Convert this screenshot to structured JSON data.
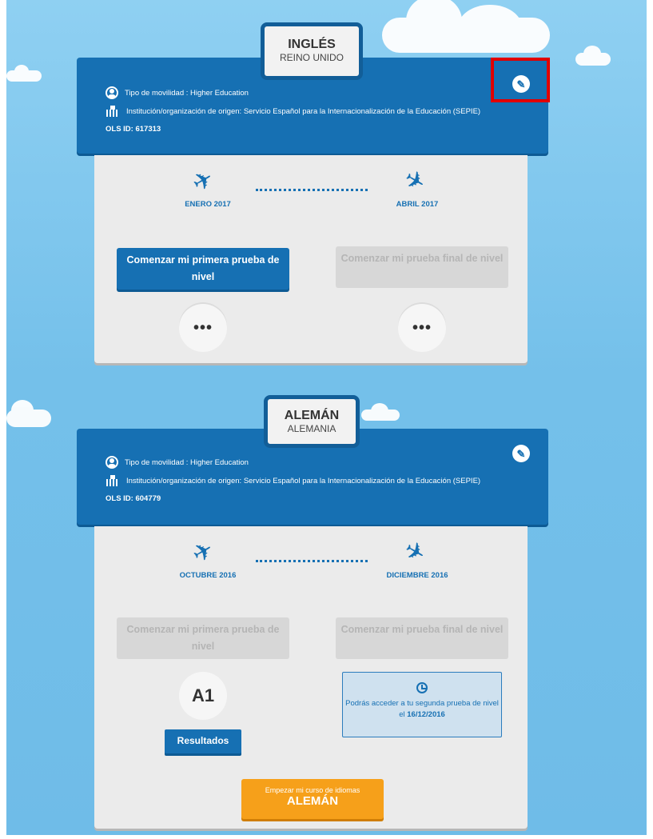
{
  "cards": [
    {
      "language": "INGLÉS",
      "country": "REINO UNIDO",
      "mobility_type": "Tipo de movilidad : Higher Education",
      "institution": "Institución/organización de origen: Servicio Español para la Internacionalización de la Educación (SEPIE)",
      "ols_id": "OLS ID: 617313",
      "start_date": "ENERO 2017",
      "end_date": "ABRIL 2017",
      "first_test_label": "Comenzar mi primera prueba de nivel",
      "final_test_label": "Comenzar mi prueba final de nivel",
      "more_label": "•••"
    },
    {
      "language": "ALEMÁN",
      "country": "ALEMANIA",
      "mobility_type": "Tipo de movilidad : Higher Education",
      "institution": "Institución/organización de origen: Servicio Español para la Internacionalización de la Educación (SEPIE)",
      "ols_id": "OLS ID: 604779",
      "start_date": "OCTUBRE 2016",
      "end_date": "DICIEMBRE 2016",
      "first_test_label": "Comenzar mi primera prueba de nivel",
      "final_test_label": "Comenzar mi prueba final de nivel",
      "level": "A1",
      "results_label": "Resultados",
      "notice_text": "Podrás acceder a tu segunda prueba de nivel el",
      "notice_date": "16/12/2016",
      "course_button_small": "Empezar mi curso de idiomas",
      "course_button_big": "ALEMÁN"
    }
  ],
  "icons": {
    "edit": "edit-icon",
    "person": "person-icon",
    "building": "building-icon",
    "plane": "plane-icon",
    "clock": "clock-icon"
  },
  "colors": {
    "primary_blue": "#1670b3",
    "orange": "#f6a01a",
    "highlight": "#e00000"
  }
}
